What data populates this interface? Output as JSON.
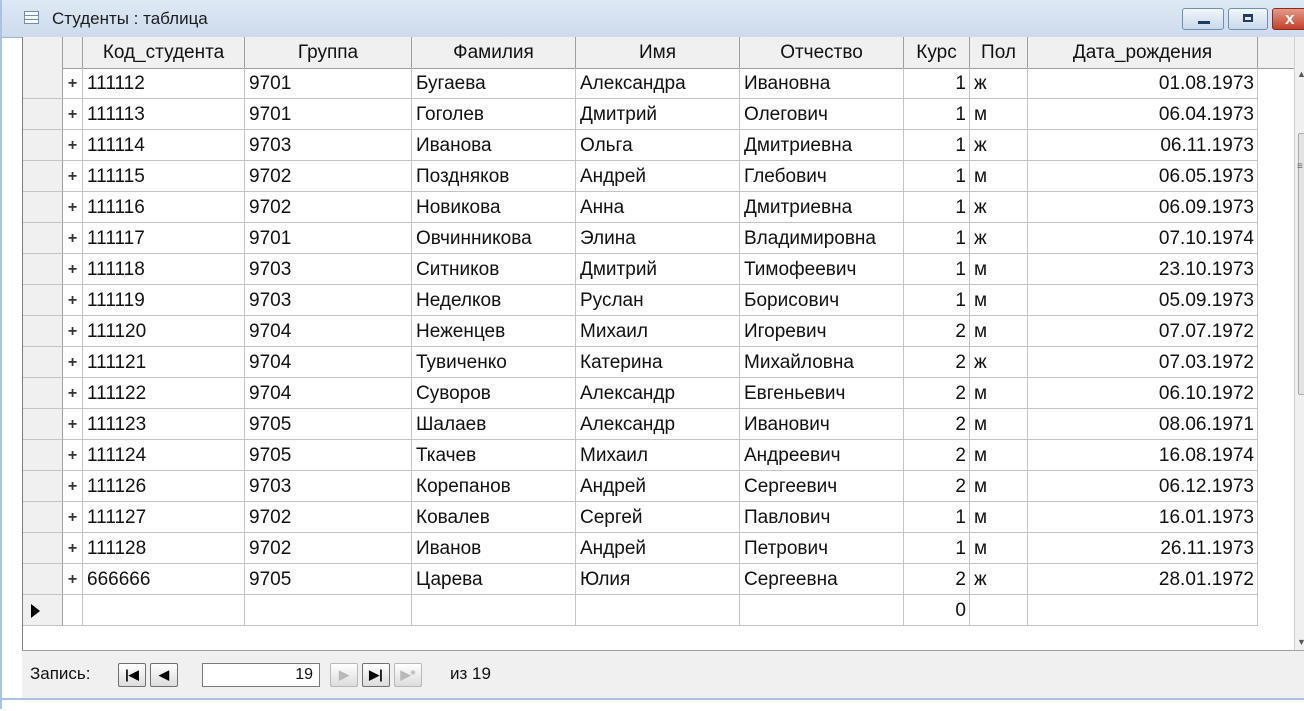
{
  "window": {
    "title": "Студенты : таблица"
  },
  "columns": [
    {
      "key": "select",
      "label": ""
    },
    {
      "key": "expand",
      "label": ""
    },
    {
      "key": "id",
      "label": "Код_студента"
    },
    {
      "key": "group",
      "label": "Группа"
    },
    {
      "key": "last",
      "label": "Фамилия"
    },
    {
      "key": "first",
      "label": "Имя"
    },
    {
      "key": "middle",
      "label": "Отчество"
    },
    {
      "key": "course",
      "label": "Курс"
    },
    {
      "key": "sex",
      "label": "Пол"
    },
    {
      "key": "dob",
      "label": "Дата_рождения"
    }
  ],
  "rows": [
    {
      "id": "111112",
      "group": "9701",
      "last": "Бугаева",
      "first": "Александра",
      "middle": "Ивановна",
      "course": "1",
      "sex": "ж",
      "dob": "01.08.1973"
    },
    {
      "id": "111113",
      "group": "9701",
      "last": "Гоголев",
      "first": "Дмитрий",
      "middle": "Олегович",
      "course": "1",
      "sex": "м",
      "dob": "06.04.1973"
    },
    {
      "id": "111114",
      "group": "9703",
      "last": "Иванова",
      "first": "Ольга",
      "middle": "Дмитриевна",
      "course": "1",
      "sex": "ж",
      "dob": "06.11.1973"
    },
    {
      "id": "111115",
      "group": "9702",
      "last": "Поздняков",
      "first": "Андрей",
      "middle": "Глебович",
      "course": "1",
      "sex": "м",
      "dob": "06.05.1973"
    },
    {
      "id": "111116",
      "group": "9702",
      "last": "Новикова",
      "first": "Анна",
      "middle": "Дмитриевна",
      "course": "1",
      "sex": "ж",
      "dob": "06.09.1973"
    },
    {
      "id": "111117",
      "group": "9701",
      "last": "Овчинникова",
      "first": "Элина",
      "middle": "Владимировна",
      "course": "1",
      "sex": "ж",
      "dob": "07.10.1974"
    },
    {
      "id": "111118",
      "group": "9703",
      "last": "Ситников",
      "first": "Дмитрий",
      "middle": "Тимофеевич",
      "course": "1",
      "sex": "м",
      "dob": "23.10.1973"
    },
    {
      "id": "111119",
      "group": "9703",
      "last": "Неделков",
      "first": "Руслан",
      "middle": "Борисович",
      "course": "1",
      "sex": "м",
      "dob": "05.09.1973"
    },
    {
      "id": "111120",
      "group": "9704",
      "last": "Неженцев",
      "first": "Михаил",
      "middle": "Игоревич",
      "course": "2",
      "sex": "м",
      "dob": "07.07.1972"
    },
    {
      "id": "111121",
      "group": "9704",
      "last": "Тувиченко",
      "first": "Катерина",
      "middle": "Михайловна",
      "course": "2",
      "sex": "ж",
      "dob": "07.03.1972"
    },
    {
      "id": "111122",
      "group": "9704",
      "last": "Суворов",
      "first": "Александр",
      "middle": "Евгеньевич",
      "course": "2",
      "sex": "м",
      "dob": "06.10.1972"
    },
    {
      "id": "111123",
      "group": "9705",
      "last": "Шалаев",
      "first": "Александр",
      "middle": "Иванович",
      "course": "2",
      "sex": "м",
      "dob": "08.06.1971"
    },
    {
      "id": "111124",
      "group": "9705",
      "last": "Ткачев",
      "first": "Михаил",
      "middle": "Андреевич",
      "course": "2",
      "sex": "м",
      "dob": "16.08.1974"
    },
    {
      "id": "111126",
      "group": "9703",
      "last": "Корепанов",
      "first": "Андрей",
      "middle": "Сергеевич",
      "course": "2",
      "sex": "м",
      "dob": "06.12.1973"
    },
    {
      "id": "111127",
      "group": "9702",
      "last": "Ковалев",
      "first": "Сергей",
      "middle": "Павлович",
      "course": "1",
      "sex": "м",
      "dob": "16.01.1973"
    },
    {
      "id": "111128",
      "group": "9702",
      "last": "Иванов",
      "first": "Андрей",
      "middle": "Петрович",
      "course": "1",
      "sex": "м",
      "dob": "26.11.1973"
    },
    {
      "id": "666666",
      "group": "9705",
      "last": "Царева",
      "first": "Юлия",
      "middle": "Сергеевна",
      "course": "2",
      "sex": "ж",
      "dob": "28.01.1972"
    }
  ],
  "new_row": {
    "course": "0"
  },
  "expand_symbol": "+",
  "navigation": {
    "label": "Запись:",
    "current_record": "19",
    "of_total": "из  19"
  }
}
